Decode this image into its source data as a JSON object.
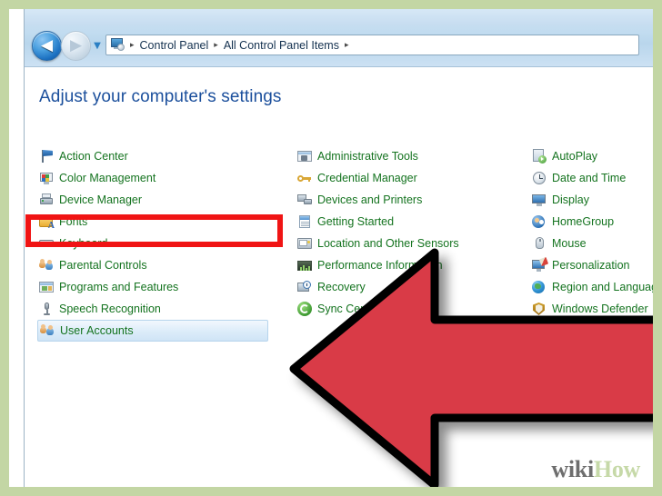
{
  "window": {
    "nav": {
      "back_glyph": "◀",
      "forward_glyph": "▶",
      "back_name": "Back",
      "forward_name": "Forward",
      "history_caret": "▼"
    },
    "address_bar": {
      "icon": "control-panel-icon",
      "separator": "▸",
      "crumbs": [
        "Control Panel",
        "All Control Panel Items"
      ]
    },
    "heading": "Adjust your computer's settings"
  },
  "items": {
    "columns": [
      [
        {
          "label": "Action Center",
          "icon": "flag-icon"
        },
        {
          "label": "Color Management",
          "icon": "color-monitor-icon"
        },
        {
          "label": "Device Manager",
          "icon": "printer-device-icon"
        },
        {
          "label": "Fonts",
          "icon": "fonts-folder-icon"
        },
        {
          "label": "Keyboard",
          "icon": "keyboard-icon"
        },
        {
          "label": "Parental Controls",
          "icon": "parental-controls-icon"
        },
        {
          "label": "Programs and Features",
          "icon": "programs-window-icon"
        },
        {
          "label": "Speech Recognition",
          "icon": "microphone-icon"
        },
        {
          "label": "User Accounts",
          "icon": "user-accounts-icon",
          "selected": true
        }
      ],
      [
        {
          "label": "Administrative Tools",
          "icon": "admin-tools-icon"
        },
        {
          "label": "Credential Manager",
          "icon": "credential-key-icon"
        },
        {
          "label": "Devices and Printers",
          "icon": "devices-printers-icon"
        },
        {
          "label": "Getting Started",
          "icon": "getting-started-icon"
        },
        {
          "label": "Location and Other Sensors",
          "icon": "location-sensor-icon"
        },
        {
          "label": "Performance Information",
          "icon": "performance-icon"
        },
        {
          "label": "Recovery",
          "icon": "recovery-icon"
        },
        {
          "label": "Sync Center",
          "icon": "sync-center-icon"
        }
      ],
      [
        {
          "label": "AutoPlay",
          "icon": "autoplay-icon"
        },
        {
          "label": "Date and Time",
          "icon": "clock-icon"
        },
        {
          "label": "Display",
          "icon": "display-icon"
        },
        {
          "label": "HomeGroup",
          "icon": "homegroup-icon"
        },
        {
          "label": "Mouse",
          "icon": "mouse-icon"
        },
        {
          "label": "Personalization",
          "icon": "personalization-icon"
        },
        {
          "label": "Region and Language",
          "icon": "region-language-icon"
        },
        {
          "label": "Windows Defender",
          "icon": "windows-defender-icon"
        }
      ]
    ]
  },
  "annotations": {
    "highlight_target": "User Accounts",
    "arrow_direction": "left",
    "arrow_points_to": "User Accounts"
  },
  "watermark": {
    "part1": "wiki",
    "part2": "How"
  },
  "colors": {
    "frame_green": "#c3d6a4",
    "item_label_green": "#14731f",
    "heading_blue": "#1b4f9c",
    "highlight_red": "#f01414",
    "arrow_red": "#d93b46",
    "arrow_outline": "#000000",
    "watermark_gray": "#6e6e6e",
    "watermark_green": "#c6d9a8"
  }
}
